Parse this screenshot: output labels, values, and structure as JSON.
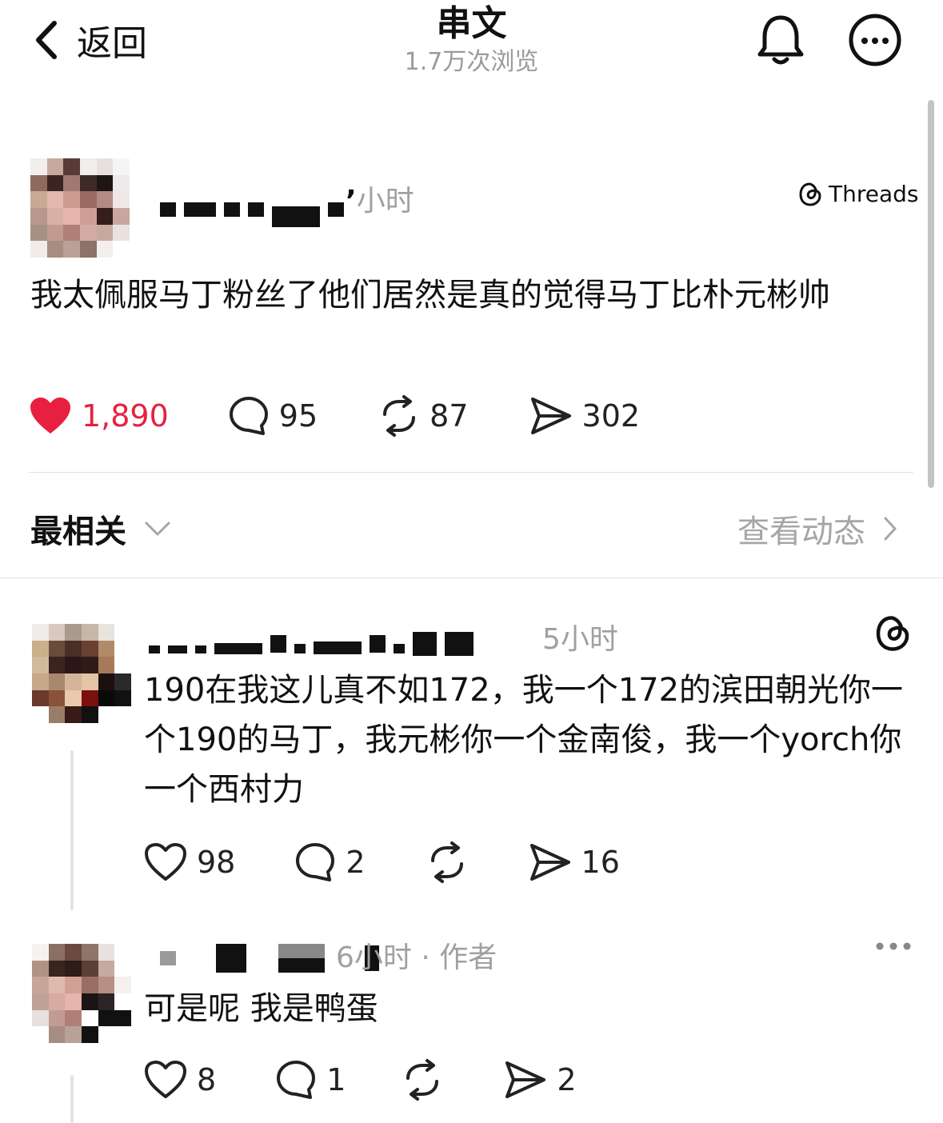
{
  "header": {
    "back_label": "返回",
    "title": "串文",
    "views": "1.7万次浏览"
  },
  "post": {
    "author_time": "小时",
    "badge": "Threads",
    "text": "我太佩服马丁粉丝了他们居然是真的觉得马丁比朴元彬帅",
    "likes": "1,890",
    "replies": "95",
    "reposts": "87",
    "shares": "302",
    "like_color": "#e8203f"
  },
  "sort": {
    "label": "最相关",
    "activity": "查看动态"
  },
  "replies": [
    {
      "time": "5小时",
      "text": "190在我这儿真不如172，我一个172的滨田朝光你一个190的马丁，我元彬你一个金南俊，我一个yorch你一个西村力",
      "likes": "98",
      "replies": "2",
      "reposts": "",
      "shares": "16"
    },
    {
      "time": "6小时 · 作者",
      "text": "可是呢 我是鸭蛋",
      "likes": "8",
      "replies": "1",
      "reposts": "",
      "shares": "2"
    }
  ]
}
